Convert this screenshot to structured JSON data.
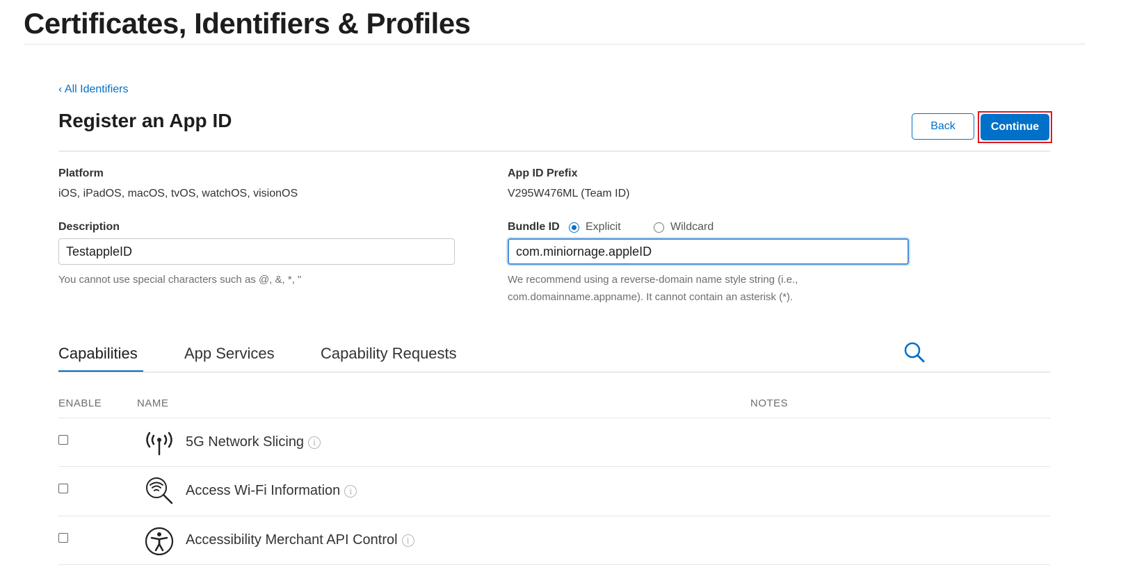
{
  "header": {
    "title": "Certificates, Identifiers & Profiles"
  },
  "nav": {
    "back_link": "‹ All Identifiers"
  },
  "form": {
    "title": "Register an App ID",
    "back_button": "Back",
    "continue_button": "Continue",
    "platform": {
      "label": "Platform",
      "value": "iOS, iPadOS, macOS, tvOS, watchOS, visionOS"
    },
    "prefix": {
      "label": "App ID Prefix",
      "value": "V295W476ML (Team ID)"
    },
    "description": {
      "label": "Description",
      "value": "TestappleID",
      "hint": "You cannot use special characters such as @, &, *, \""
    },
    "bundle": {
      "label": "Bundle ID",
      "options": [
        "Explicit",
        "Wildcard"
      ],
      "selected": "Explicit",
      "value": "com.miniornage.appleID",
      "hint_line1": "We recommend using a reverse-domain name style string (i.e.,",
      "hint_line2": "com.domainname.appname). It cannot contain an asterisk (*)."
    }
  },
  "tabs": [
    {
      "label": "Capabilities",
      "active": true
    },
    {
      "label": "App Services",
      "active": false
    },
    {
      "label": "Capability Requests",
      "active": false
    }
  ],
  "table": {
    "columns": {
      "enable": "ENABLE",
      "name": "NAME",
      "notes": "NOTES"
    },
    "rows": [
      {
        "name": "5G Network Slicing",
        "icon": "antenna-icon",
        "enabled": false
      },
      {
        "name": "Access Wi-Fi Information",
        "icon": "wifi-search-icon",
        "enabled": false
      },
      {
        "name": "Accessibility Merchant API Control",
        "icon": "accessibility-icon",
        "enabled": false
      }
    ]
  },
  "colors": {
    "accent": "#0070c9",
    "highlight": "#e0161c"
  }
}
